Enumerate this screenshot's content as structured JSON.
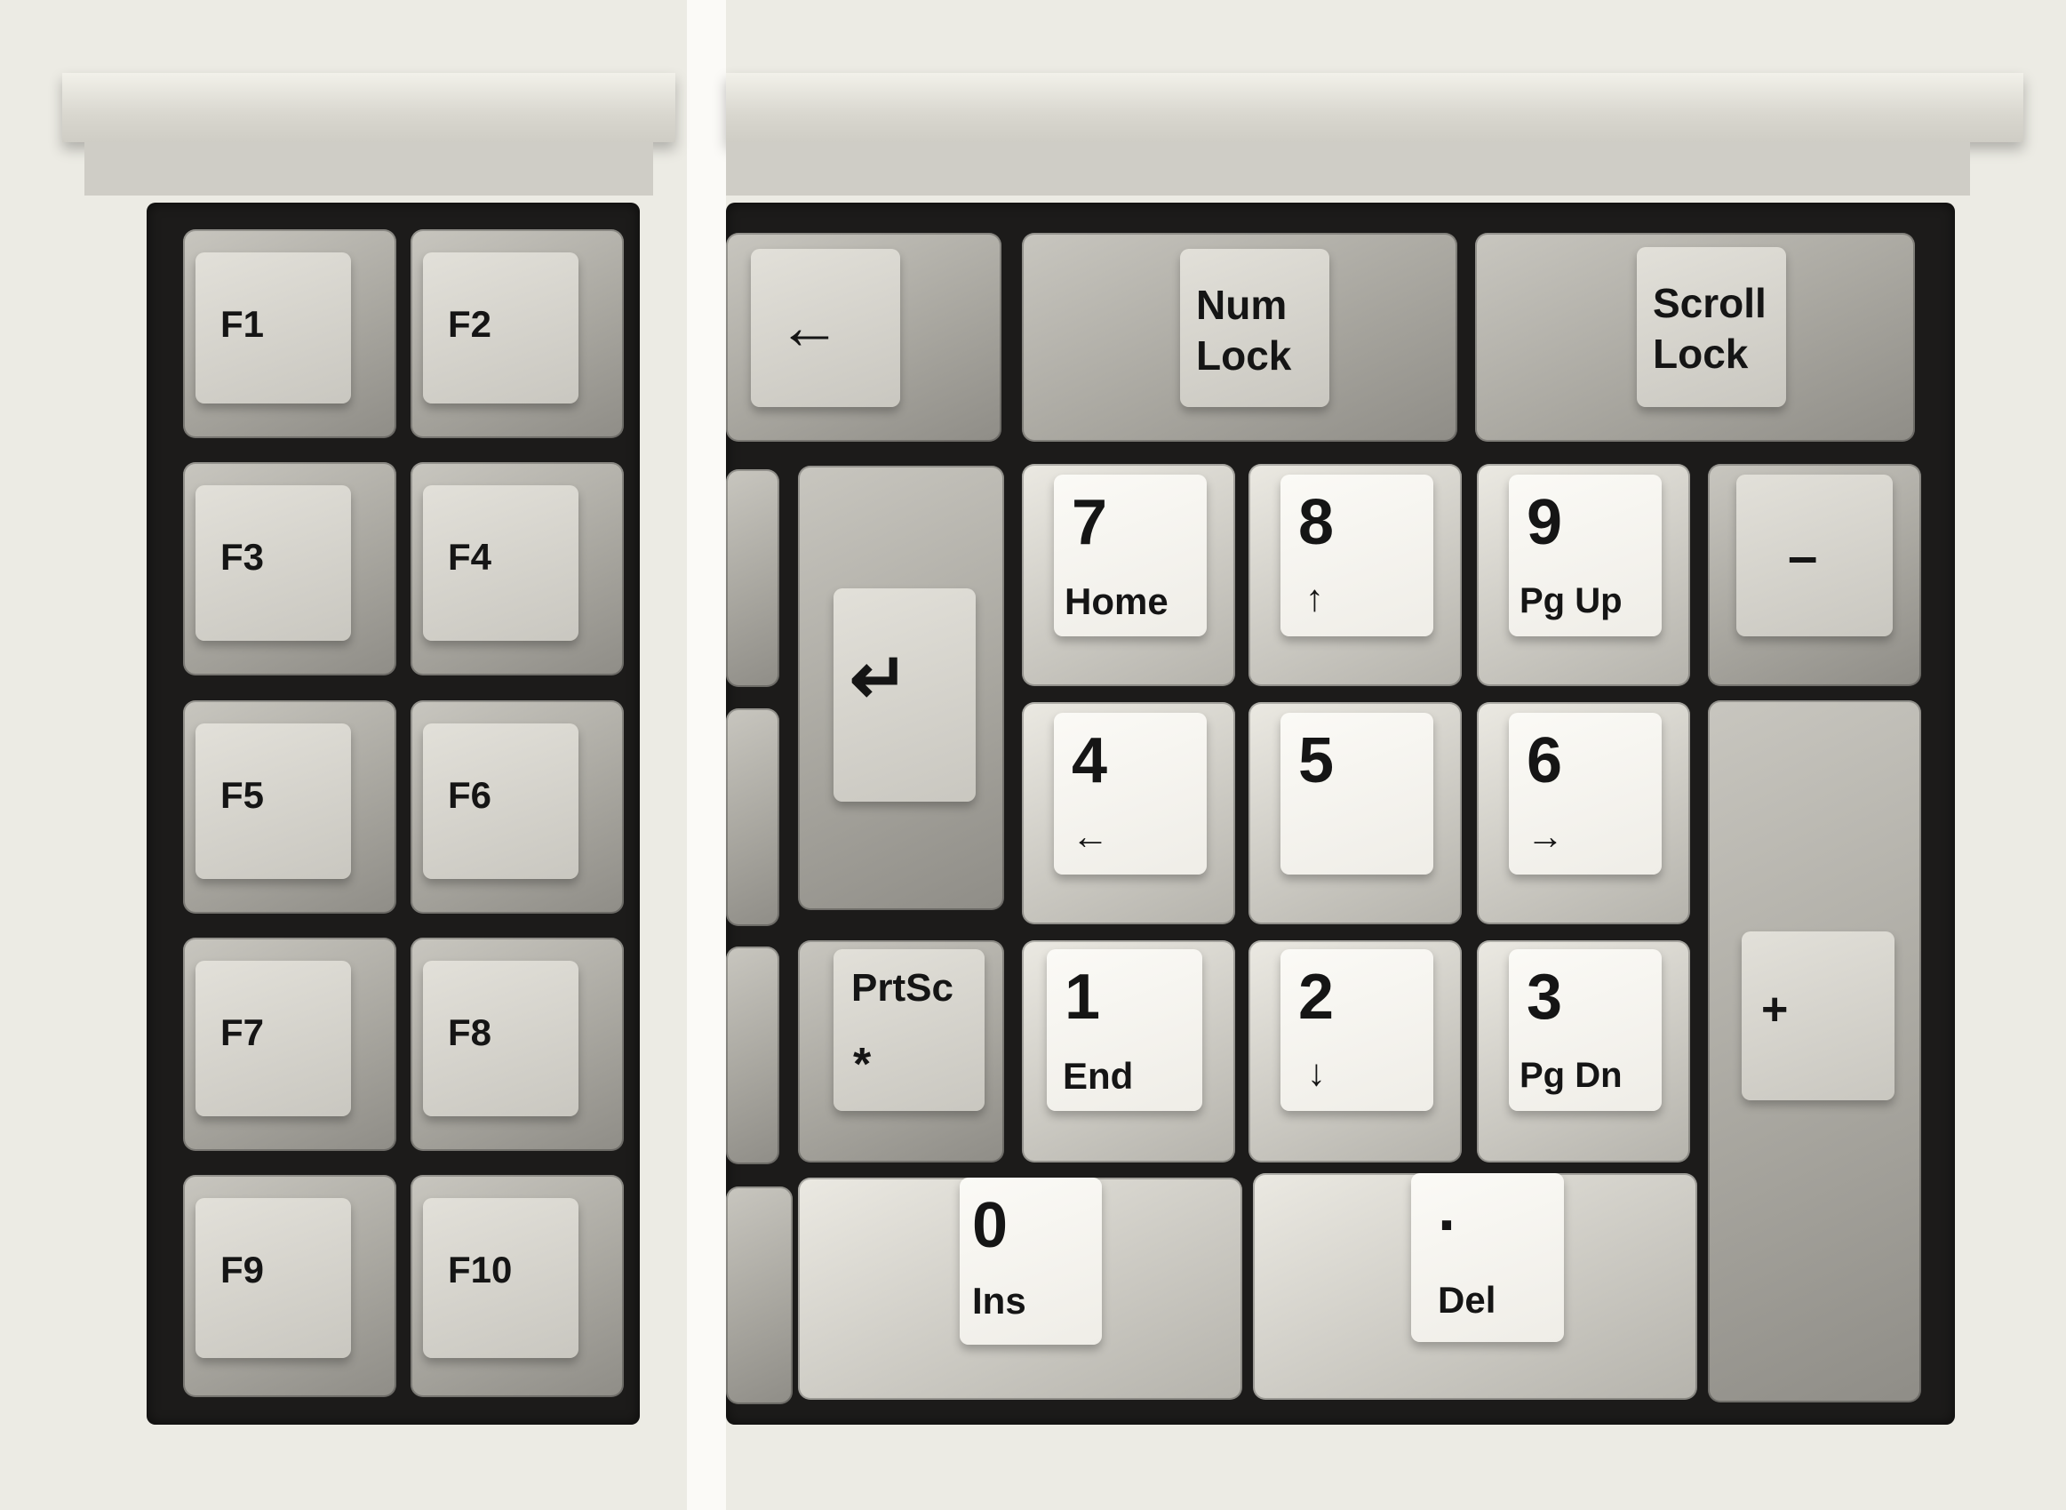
{
  "function_keys": [
    "F1",
    "F2",
    "F3",
    "F4",
    "F5",
    "F6",
    "F7",
    "F8",
    "F9",
    "F10"
  ],
  "numpad": {
    "backspace": "←",
    "num_lock": [
      "Num",
      "Lock"
    ],
    "scroll_lock": [
      "Scroll",
      "Lock"
    ],
    "enter": "↵",
    "prtsc": {
      "main": "PrtSc",
      "sub": "*"
    },
    "k7": {
      "main": "7",
      "sub": "Home"
    },
    "k8": {
      "main": "8",
      "sub": "↑"
    },
    "k9": {
      "main": "9",
      "sub": "Pg Up"
    },
    "k4": {
      "main": "4",
      "sub": "←"
    },
    "k5": {
      "main": "5",
      "sub": ""
    },
    "k6": {
      "main": "6",
      "sub": "→"
    },
    "k1": {
      "main": "1",
      "sub": "End"
    },
    "k2": {
      "main": "2",
      "sub": "↓"
    },
    "k3": {
      "main": "3",
      "sub": "Pg Dn"
    },
    "k0": {
      "main": "0",
      "sub": "Ins"
    },
    "kdot": {
      "main": ".",
      "sub": "Del"
    },
    "minus": "–",
    "plus": "+"
  }
}
